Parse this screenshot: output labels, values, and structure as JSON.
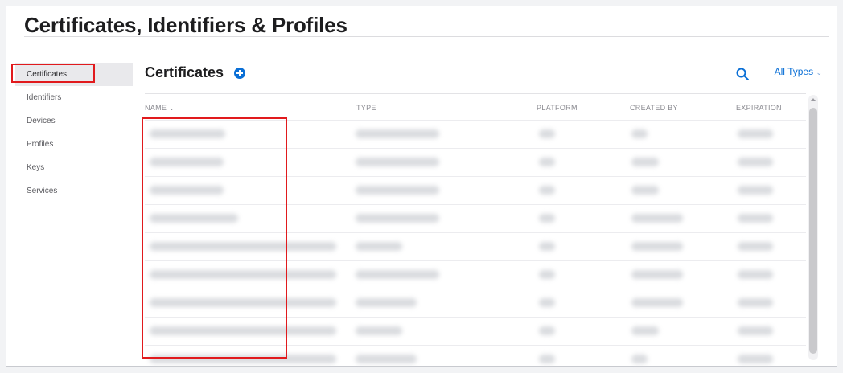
{
  "page": {
    "title": "Certificates, Identifiers & Profiles"
  },
  "sidebar": {
    "items": [
      {
        "label": "Certificates",
        "active": true
      },
      {
        "label": "Identifiers"
      },
      {
        "label": "Devices"
      },
      {
        "label": "Profiles"
      },
      {
        "label": "Keys"
      },
      {
        "label": "Services"
      }
    ]
  },
  "main": {
    "title": "Certificates",
    "add_icon": "plus-circle-icon",
    "search_icon": "search-icon",
    "filter_label": "All Types",
    "filter_chevron": "⌄",
    "colors": {
      "accent": "#0a6fd6",
      "highlight": "#e11a1d"
    }
  },
  "table": {
    "columns": [
      "NAME",
      "TYPE",
      "PLATFORM",
      "CREATED BY",
      "EXPIRATION"
    ],
    "sort_indicator": "⌄",
    "rows": [
      {
        "name": "",
        "type": "",
        "platform": "",
        "created": "",
        "expiration": ""
      },
      {
        "name": "",
        "type": "",
        "platform": "",
        "created": "",
        "expiration": ""
      },
      {
        "name": "",
        "type": "",
        "platform": "",
        "created": "",
        "expiration": ""
      },
      {
        "name": "",
        "type": "",
        "platform": "",
        "created": "",
        "expiration": ""
      },
      {
        "name": "",
        "type": "",
        "platform": "",
        "created": "",
        "expiration": ""
      },
      {
        "name": "",
        "type": "",
        "platform": "",
        "created": "",
        "expiration": ""
      },
      {
        "name": "",
        "type": "",
        "platform": "",
        "created": "",
        "expiration": ""
      },
      {
        "name": "",
        "type": "",
        "platform": "",
        "created": "",
        "expiration": ""
      },
      {
        "name": "",
        "type": "",
        "platform": "",
        "created": "",
        "expiration": ""
      }
    ]
  }
}
